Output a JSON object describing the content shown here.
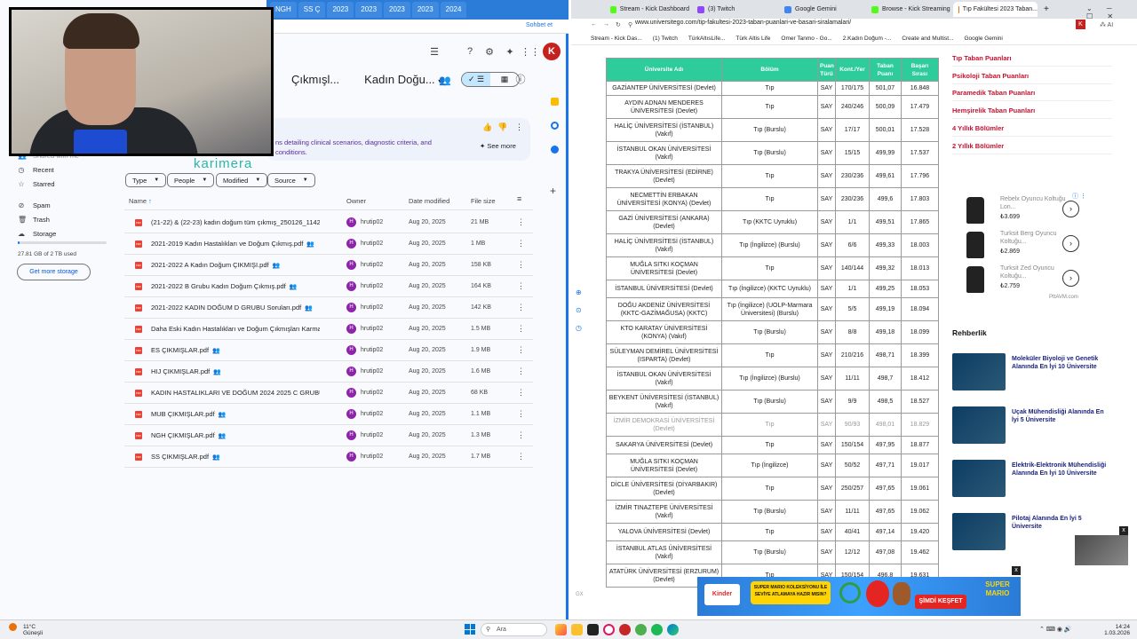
{
  "left": {
    "tabs": [
      "NGH",
      "SS Ç",
      "2023",
      "2023",
      "2023",
      "2023",
      "2024"
    ],
    "addr_button": "Sohbet et",
    "avatar": "K",
    "breadcrumb": [
      "Çıkmışl...",
      "Kadın Doğu..."
    ],
    "ai_text": "ns detailing clinical scenarios, diagnostic criteria, and conditions.",
    "see_more": "See more",
    "overlay_text": "karimera",
    "sidebar": [
      {
        "label": "Shared with me",
        "icon": "people-icon"
      },
      {
        "label": "Recent",
        "icon": "clock-icon"
      },
      {
        "label": "Starred",
        "icon": "star-icon"
      },
      {
        "label": "Spam",
        "icon": "spam-icon"
      },
      {
        "label": "Trash",
        "icon": "trash-icon"
      },
      {
        "label": "Storage",
        "icon": "cloud-icon"
      }
    ],
    "storage_used": "27.81 GB of 2 TB used",
    "storage_fraction": 0.014,
    "get_storage": "Get more storage",
    "filters": [
      "Type",
      "People",
      "Modified",
      "Source"
    ],
    "columns": {
      "name": "Name",
      "owner": "Owner",
      "date": "Date modified",
      "size": "File size"
    },
    "files": [
      {
        "name": "(21-22) & (22-23) kadın doğum tüm çıkmış_250126_11422...",
        "owner": "hrutip02",
        "date": "Aug 20, 2025",
        "size": "21 MB"
      },
      {
        "name": "2021-2019 Kadın Hastalıkları ve Doğum Çıkmış.pdf",
        "owner": "hrutip02",
        "date": "Aug 20, 2025",
        "size": "1 MB"
      },
      {
        "name": "2021-2022 A Kadın Doğum ÇIKMIŞI.pdf",
        "owner": "hrutip02",
        "date": "Aug 20, 2025",
        "size": "158 KB"
      },
      {
        "name": "2021-2022 B Grubu Kadın Doğum Çıkmış.pdf",
        "owner": "hrutip02",
        "date": "Aug 20, 2025",
        "size": "164 KB"
      },
      {
        "name": "2021-2022 KADIN DOĞUM D GRUBU Soruları.pdf",
        "owner": "hrutip02",
        "date": "Aug 20, 2025",
        "size": "142 KB"
      },
      {
        "name": "Daha Eski Kadın Hastalıkları ve Doğum Çıkmışları Karma....",
        "owner": "hrutip02",
        "date": "Aug 20, 2025",
        "size": "1.5 MB"
      },
      {
        "name": "ES ÇIKMIŞLAR.pdf",
        "owner": "hrutip02",
        "date": "Aug 20, 2025",
        "size": "1.9 MB"
      },
      {
        "name": "HIJ ÇIKMIŞLAR.pdf",
        "owner": "hrutip02",
        "date": "Aug 20, 2025",
        "size": "1.6 MB"
      },
      {
        "name": "KADIN HASTALIKLARI VE DOĞUM 2024 2025 C GRUBU_...",
        "owner": "hrutip02",
        "date": "Aug 20, 2025",
        "size": "68 KB"
      },
      {
        "name": "MUB ÇIKMIŞLAR.pdf",
        "owner": "hrutip02",
        "date": "Aug 20, 2025",
        "size": "1.1 MB"
      },
      {
        "name": "NGH ÇIKMIŞLAR.pdf",
        "owner": "hrutip02",
        "date": "Aug 20, 2025",
        "size": "1.3 MB"
      },
      {
        "name": "SS ÇIKMIŞLAR.pdf",
        "owner": "hrutip02",
        "date": "Aug 20, 2025",
        "size": "1.7 MB"
      }
    ]
  },
  "right": {
    "tabs": [
      {
        "label": "Stream - Kick Dashboard",
        "color": "#53fc18"
      },
      {
        "label": "(3) Twitch",
        "color": "#9146ff"
      },
      {
        "label": "Google Gemini",
        "color": "#4285f4"
      },
      {
        "label": "Browse - Kick Streaming",
        "color": "#53fc18"
      },
      {
        "label": "Tıp Fakültesi 2023 Taban...",
        "color": "#e8710a"
      }
    ],
    "url": "www.universitego.com/tip-fakultesi-2023-taban-puanlari-ve-basari-siralamalari/",
    "bookmarks": [
      "Stream - Kick Das...",
      "(1) Twitch",
      "TürkAltısLife...",
      "Türk Altis Life",
      "Omer Tanmo - Go...",
      "2.Kadın Doğum -...",
      "Create and Multist...",
      "Google Gemini"
    ],
    "top_row": {
      "uni": "GAZİANTEP ÜNİVERSİTESİ (Devlet)",
      "dept": "Tıp",
      "type": "SAY",
      "quota": "170/175",
      "score": "501,07",
      "rank": "16.848"
    },
    "table_head": [
      "Üniversite Adı",
      "Bölüm",
      "Puan Türü",
      "Kont./Yer",
      "Taban Puanı",
      "Başarı Sırası"
    ],
    "rows": [
      {
        "uni": "AYDIN ADNAN MENDERES ÜNİVERSİTESİ (Devlet)",
        "dept": "Tıp",
        "type": "SAY",
        "quota": "240/246",
        "score": "500,09",
        "rank": "17.479"
      },
      {
        "uni": "HALİÇ ÜNİVERSİTESİ (İSTANBUL) (Vakıf)",
        "dept": "Tıp (Burslu)",
        "type": "SAY",
        "quota": "17/17",
        "score": "500,01",
        "rank": "17.528"
      },
      {
        "uni": "İSTANBUL OKAN ÜNİVERSİTESİ (Vakıf)",
        "dept": "Tıp (Burslu)",
        "type": "SAY",
        "quota": "15/15",
        "score": "499,99",
        "rank": "17.537"
      },
      {
        "uni": "TRAKYA ÜNİVERSİTESİ (EDİRNE) (Devlet)",
        "dept": "Tıp",
        "type": "SAY",
        "quota": "230/236",
        "score": "499,61",
        "rank": "17.796"
      },
      {
        "uni": "NECMETTİN ERBAKAN ÜNİVERSİTESİ (KONYA) (Devlet)",
        "dept": "Tıp",
        "type": "SAY",
        "quota": "230/236",
        "score": "499,6",
        "rank": "17.803"
      },
      {
        "uni": "GAZİ ÜNİVERSİTESİ (ANKARA) (Devlet)",
        "dept": "Tıp (KKTC Uyruklu)",
        "type": "SAY",
        "quota": "1/1",
        "score": "499,51",
        "rank": "17.865"
      },
      {
        "uni": "HALİÇ ÜNİVERSİTESİ (İSTANBUL) (Vakıf)",
        "dept": "Tıp (İngilizce) (Burslu)",
        "type": "SAY",
        "quota": "6/6",
        "score": "499,33",
        "rank": "18.003"
      },
      {
        "uni": "MUĞLA SITKI KOÇMAN ÜNİVERSİTESİ (Devlet)",
        "dept": "Tıp",
        "type": "SAY",
        "quota": "140/144",
        "score": "499,32",
        "rank": "18.013"
      },
      {
        "uni": "İSTANBUL ÜNİVERSİTESİ (Devlet)",
        "dept": "Tıp (İngilizce) (KKTC Uyruklu)",
        "type": "SAY",
        "quota": "1/1",
        "score": "499,25",
        "rank": "18.053"
      },
      {
        "uni": "DOĞU AKDENİZ ÜNİVERSİTESİ (KKTC-GAZİMAĞUSA) (KKTC)",
        "dept": "Tıp (İngilizce) (UOLP-Marmara Üniversitesi) (Burslu)",
        "type": "SAY",
        "quota": "5/5",
        "score": "499,19",
        "rank": "18.094"
      },
      {
        "uni": "KTO KARATAY ÜNİVERSİTESİ (KONYA) (Vakıf)",
        "dept": "Tıp (Burslu)",
        "type": "SAY",
        "quota": "8/8",
        "score": "499,18",
        "rank": "18.099"
      },
      {
        "uni": "SÜLEYMAN DEMİREL ÜNİVERSİTESİ (ISPARTA) (Devlet)",
        "dept": "Tıp",
        "type": "SAY",
        "quota": "210/216",
        "score": "498,71",
        "rank": "18.399"
      },
      {
        "uni": "İSTANBUL OKAN ÜNİVERSİTESİ (Vakıf)",
        "dept": "Tıp (İngilizce) (Burslu)",
        "type": "SAY",
        "quota": "11/11",
        "score": "498,7",
        "rank": "18.412"
      },
      {
        "uni": "BEYKENT ÜNİVERSİTESİ (İSTANBUL) (Vakıf)",
        "dept": "Tıp (Burslu)",
        "type": "SAY",
        "quota": "9/9",
        "score": "498,5",
        "rank": "18.527"
      },
      {
        "uni": "İZMİR DEMOKRASİ ÜNİVERSİTESİ (Devlet)",
        "dept": "Tıp",
        "type": "SAY",
        "quota": "90/93",
        "score": "498,01",
        "rank": "18.829",
        "faded": true
      },
      {
        "uni": "SAKARYA ÜNİVERSİTESİ (Devlet)",
        "dept": "Tıp",
        "type": "SAY",
        "quota": "150/154",
        "score": "497,95",
        "rank": "18.877"
      },
      {
        "uni": "MUĞLA SITKI KOÇMAN ÜNİVERSİTESİ (Devlet)",
        "dept": "Tıp (İngilizce)",
        "type": "SAY",
        "quota": "50/52",
        "score": "497,71",
        "rank": "19.017"
      },
      {
        "uni": "DİCLE ÜNİVERSİTESİ (DİYARBAKIR) (Devlet)",
        "dept": "Tıp",
        "type": "SAY",
        "quota": "250/257",
        "score": "497,65",
        "rank": "19.061"
      },
      {
        "uni": "İZMİR TINAZTEPE ÜNİVERSİTESİ (Vakıf)",
        "dept": "Tıp (Burslu)",
        "type": "SAY",
        "quota": "11/11",
        "score": "497,65",
        "rank": "19.062"
      },
      {
        "uni": "YALOVA ÜNİVERSİTESİ (Devlet)",
        "dept": "Tıp",
        "type": "SAY",
        "quota": "40/41",
        "score": "497,14",
        "rank": "19.420"
      },
      {
        "uni": "İSTANBUL ATLAS ÜNİVERSİTESİ (Vakıf)",
        "dept": "Tıp (Burslu)",
        "type": "SAY",
        "quota": "12/12",
        "score": "497,08",
        "rank": "19.462"
      },
      {
        "uni": "ATATÜRK ÜNİVERSİTESİ (ERZURUM) (Devlet)",
        "dept": "Tıp",
        "type": "SAY",
        "quota": "150/154",
        "score": "496,8",
        "rank": "19.631"
      }
    ],
    "side_links": [
      "Tıp Taban Puanları",
      "Psikoloji Taban Puanları",
      "Paramedik Taban Puanları",
      "Hemşirelik Taban Puanları",
      "4 Yıllık Bölümler",
      "2 Yıllık Bölümler"
    ],
    "products": [
      {
        "name": "Rebelx Oyuncu Koltuğu Lon...",
        "price": "₺3.699"
      },
      {
        "name": "Turksit Berg Oyuncu Koltuğu...",
        "price": "₺2.869"
      },
      {
        "name": "Turksit Zed Oyuncu Koltuğu...",
        "price": "₺2.759"
      }
    ],
    "pttavm": "PttAVM.com",
    "rehberlik": "Rehberlik",
    "articles": [
      "Moleküler Biyoloji ve Genetik Alanında En İyi 10 Üniversite",
      "Uçak Mühendisliği Alanında En İyi 5 Üniversite",
      "Elektrik-Elektronik Mühendisliği Alanında En İyi 10 Üniversite",
      "Pilotaj Alanında En İyi 5 Üniversite"
    ],
    "ad": {
      "question": "SUPER MARIO KOLEKSİYONU İLE SEVİYE ATLAMAYA HAZIR MISIN?",
      "cta": "ŞİMDİ KEŞFET",
      "brand": "SUPER MARIO",
      "kinder": "Kinder"
    },
    "close": "x"
  },
  "taskbar": {
    "weather_temp": "11°C",
    "weather_desc": "Güneşli",
    "search": "Ara",
    "time": "14:24",
    "date": "1.03.2026"
  }
}
